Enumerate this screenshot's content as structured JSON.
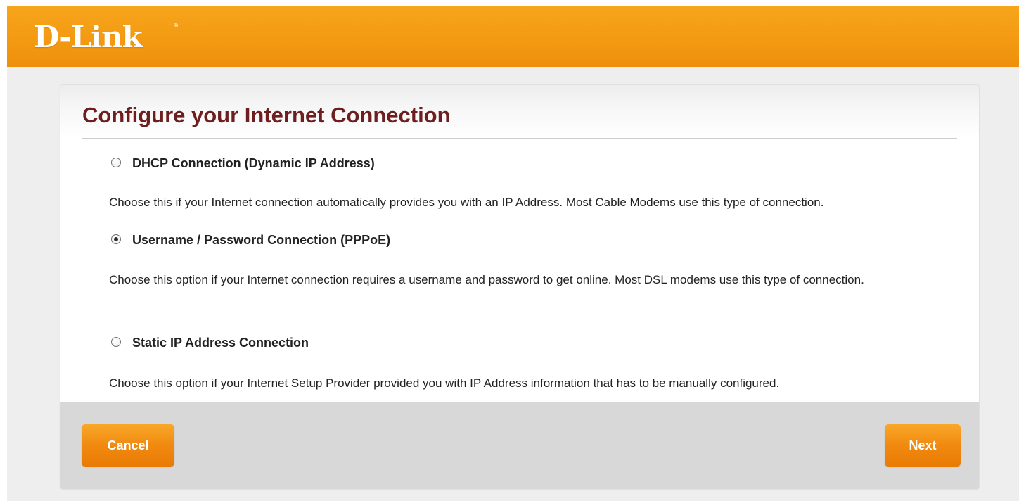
{
  "header": {
    "logo_text": "D-Link",
    "logo_mark": "®"
  },
  "colors": {
    "brand_orange": "#f39a12",
    "title_color": "#6e1e1e",
    "button_orange": "#f08a0f",
    "footer_gray": "#d8d8d8"
  },
  "page": {
    "title": "Configure your Internet Connection"
  },
  "options": [
    {
      "label": "DHCP Connection (Dynamic IP Address)",
      "description": "Choose this if your Internet connection automatically provides you with an IP Address. Most Cable Modems use this type of connection.",
      "selected": false
    },
    {
      "label": "Username / Password Connection (PPPoE)",
      "description": "Choose this option if your Internet connection requires a username and password to get online. Most DSL modems use this type of connection.",
      "selected": true
    },
    {
      "label": "Static IP Address Connection",
      "description": "Choose this option if your Internet Setup Provider provided you with IP Address information that has to be manually configured.",
      "selected": false
    }
  ],
  "buttons": {
    "cancel_label": "Cancel",
    "next_label": "Next"
  }
}
